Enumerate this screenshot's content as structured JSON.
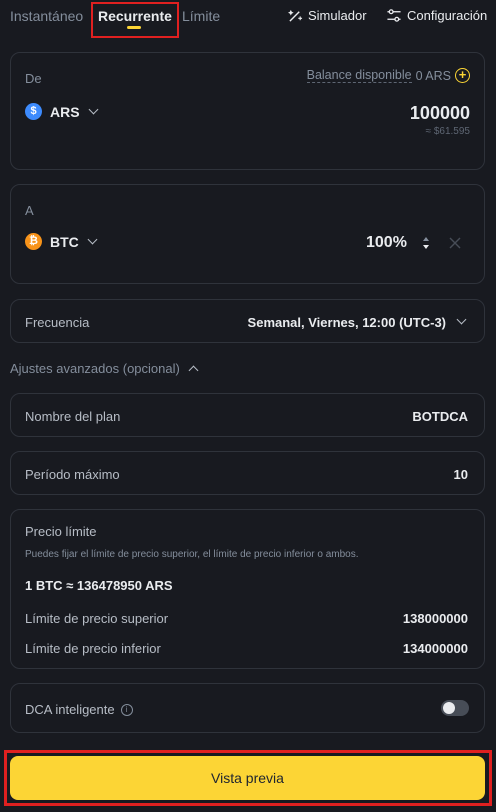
{
  "tabs": {
    "instant": "Instantáneo",
    "recurring": "Recurrente",
    "limit": "Límite"
  },
  "toolbar": {
    "simulator": "Simulador",
    "settings": "Configuración"
  },
  "from": {
    "label": "De",
    "balance_label": "Balance disponible",
    "balance_value": "0 ARS",
    "currency": "ARS",
    "amount": "100000",
    "approx": "≈ $61.595"
  },
  "to": {
    "label": "A",
    "currency": "BTC",
    "percent": "100%"
  },
  "frequency": {
    "label": "Frecuencia",
    "value": "Semanal, Viernes, 12:00 (UTC-3)"
  },
  "advanced": {
    "label": "Ajustes avanzados (opcional)"
  },
  "plan_name": {
    "label": "Nombre del plan",
    "value": "BOTDCA"
  },
  "max_period": {
    "label": "Período máximo",
    "value": "10"
  },
  "price_limit": {
    "title": "Precio límite",
    "description": "Puedes fijar el límite de precio superior, el límite de precio inferior o ambos.",
    "rate": "1 BTC ≈ 136478950 ARS",
    "upper_label": "Límite de precio superior",
    "upper_value": "138000000",
    "lower_label": "Límite de precio inferior",
    "lower_value": "134000000"
  },
  "smart_dca": {
    "label": "DCA inteligente",
    "enabled": false
  },
  "preview_button": "Vista previa",
  "colors": {
    "accent": "#fcd535",
    "highlight": "#e02020",
    "ars_coin": "#3d8bfd",
    "btc_coin": "#f7931a"
  }
}
